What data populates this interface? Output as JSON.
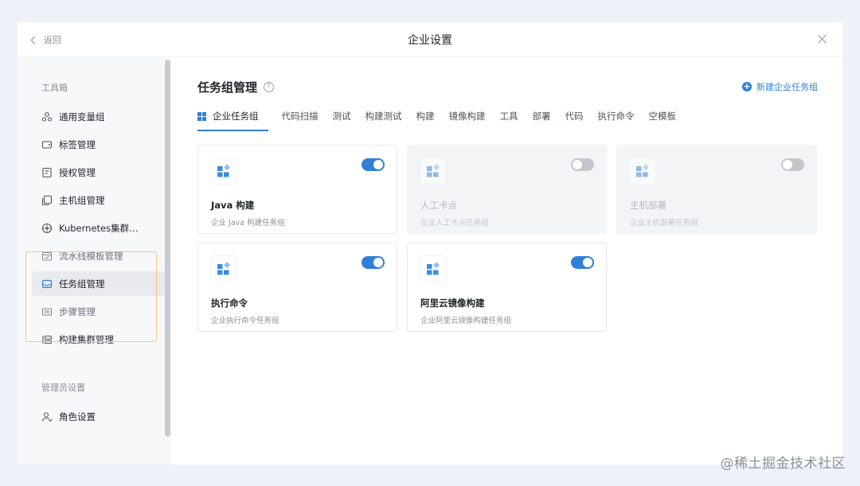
{
  "header": {
    "back_label": "返回",
    "title": "企业设置"
  },
  "sidebar": {
    "toolbox_label": "工具箱",
    "items": [
      {
        "label": "通用变量组",
        "icon": "variable-group-icon",
        "state": "normal"
      },
      {
        "label": "标签管理",
        "icon": "tag-icon",
        "state": "normal"
      },
      {
        "label": "授权管理",
        "icon": "authorization-icon",
        "state": "normal"
      },
      {
        "label": "主机组管理",
        "icon": "host-group-icon",
        "state": "normal"
      },
      {
        "label": "Kubernetes集群…",
        "icon": "kubernetes-icon",
        "state": "normal"
      },
      {
        "label": "流水线模板管理",
        "icon": "pipeline-template-icon",
        "state": "muted"
      },
      {
        "label": "任务组管理",
        "icon": "task-group-icon",
        "state": "active"
      },
      {
        "label": "步骤管理",
        "icon": "step-icon",
        "state": "muted"
      },
      {
        "label": "构建集群管理",
        "icon": "build-cluster-icon",
        "state": "normal"
      }
    ],
    "admin_label": "管理员设置",
    "admin_items": [
      {
        "label": "角色设置",
        "icon": "role-icon"
      }
    ]
  },
  "main": {
    "title": "任务组管理",
    "help_glyph": "?",
    "new_button": "新建企业任务组",
    "tabs": [
      "企业任务组",
      "代码扫描",
      "测试",
      "构建测试",
      "构建",
      "镜像构建",
      "工具",
      "部署",
      "代码",
      "执行命令",
      "空模板"
    ],
    "cards": [
      {
        "name": "Java 构建",
        "desc": "企业 Java 构建任务组",
        "enabled": true
      },
      {
        "name": "人工卡点",
        "desc": "企业人工卡点任务组",
        "enabled": false
      },
      {
        "name": "主机部署",
        "desc": "企业主机部署任务组",
        "enabled": false
      },
      {
        "name": "执行命令",
        "desc": "企业执行命令任务组",
        "enabled": true
      },
      {
        "name": "阿里云镜像构建",
        "desc": "企业阿里云镜像构建任务组",
        "enabled": true
      }
    ]
  },
  "watermark": "@稀土掘金技术社区",
  "colors": {
    "accent": "#2f7fd8",
    "highlight_border": "#f5c387",
    "toggle_off": "#c3c7cc"
  }
}
